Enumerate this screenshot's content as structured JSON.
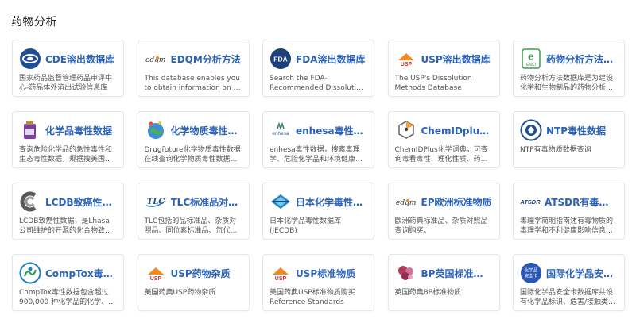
{
  "section": {
    "title": "药物分析"
  },
  "cards": [
    {
      "title": "CDE溶出数据库",
      "desc": "国家药品监督管理药品审评中心-药品体外溶出试验信息库",
      "icon": "cde-logo-icon"
    },
    {
      "title": "EDQM分析方法",
      "desc": "This database enables you to obtain information on a given...",
      "icon": "edqm-logo-icon"
    },
    {
      "title": "FDA溶出数据库",
      "desc": "Search the FDA-Recommended Dissolution Methods",
      "icon": "fda-logo-icon"
    },
    {
      "title": "USP溶出数据库",
      "desc": "The USP's Dissolution Methods Database",
      "icon": "usp-logo-icon"
    },
    {
      "title": "药物分析方法查询",
      "desc": "药物分析方法数据库是为建设化学和生物制品的药物分析方法...",
      "icon": "enci-logo-icon"
    },
    {
      "title": "化学品毒性数据",
      "desc": "查询危险化学品的急性毒性和生态毒性数据，规据搜美国国家医...",
      "icon": "chemical-bottle-icon"
    },
    {
      "title": "化学物质毒性数据",
      "desc": "Drugfuture化学物质毒性数据在线查询化学物质毒性数据库，以...",
      "icon": "globe-molecule-icon"
    },
    {
      "title": "enhesa毒性数据",
      "desc": "enhesa毒性数据，搜索毒理学、危险化学品和环境健康数据库的...",
      "icon": "enhesa-logo-icon"
    },
    {
      "title": "ChemIDplus化学...",
      "desc": "ChemIDPlus化学词典，可查询毒看毒性、理化性质、药品代码等信...",
      "icon": "chemidplus-logo-icon"
    },
    {
      "title": "NTP毒性数据",
      "desc": "NTP有毒物质数据查询",
      "icon": "ntp-logo-icon"
    },
    {
      "title": "LCDB致癌性数据",
      "desc": "LCDB致癌性数据，是Lhasa 公司维护的开源的化合物致癌性数...",
      "icon": "lcdb-logo-icon"
    },
    {
      "title": "TLC标准品对照品",
      "desc": "TLC包括的品标准品、杂质对照品、同位素标准品、氘代对照...",
      "icon": "tlc-logo-icon"
    },
    {
      "title": "日本化学毒性数据",
      "desc": "日本化学品毒性数据库 (JECDB)",
      "icon": "jecdb-logo-icon"
    },
    {
      "title": "EP欧洲标准物质",
      "desc": "欧洲药典标准品、杂质对照品查询购买。",
      "icon": "edqm-logo-icon"
    },
    {
      "title": "ATSDR有毒物质",
      "desc": "毒理学简明指南述有毒物质的毒理学和不利健康影响信息，毒物...",
      "icon": "atsdr-logo-icon"
    },
    {
      "title": "CompTox毒性数据",
      "desc": "CompTox毒性数据包含超过900,000 种化学品的化学、毒性...",
      "icon": "epa-logo-icon"
    },
    {
      "title": "USP药物杂质",
      "desc": "美国药典USP药物杂质",
      "icon": "usp-logo-icon"
    },
    {
      "title": "USP标准物质",
      "desc": "美国药典USP标准物质购买 Reference Standards",
      "icon": "usp-logo-icon"
    },
    {
      "title": "BP英国标准物质",
      "desc": "英国药典BP标准物质",
      "icon": "bp-logo-icon"
    },
    {
      "title": "国际化学品安全卡",
      "desc": "国际化学品安全卡数据库共设有化学品标识、危害/接触类型、...",
      "icon": "icsc-logo-icon"
    }
  ],
  "logos": {
    "edqm": "edqm",
    "fda": "FDA",
    "usp": "USP",
    "enci": "ENCI",
    "enhesa": "enhesa",
    "tlc": "TLC",
    "atsdr": "ATSDR",
    "icsc_line1": "化学品",
    "icsc_line2": "安全卡"
  },
  "colors": {
    "title": "#2b63b8",
    "border": "#e2e7ee",
    "desc": "#555555"
  }
}
